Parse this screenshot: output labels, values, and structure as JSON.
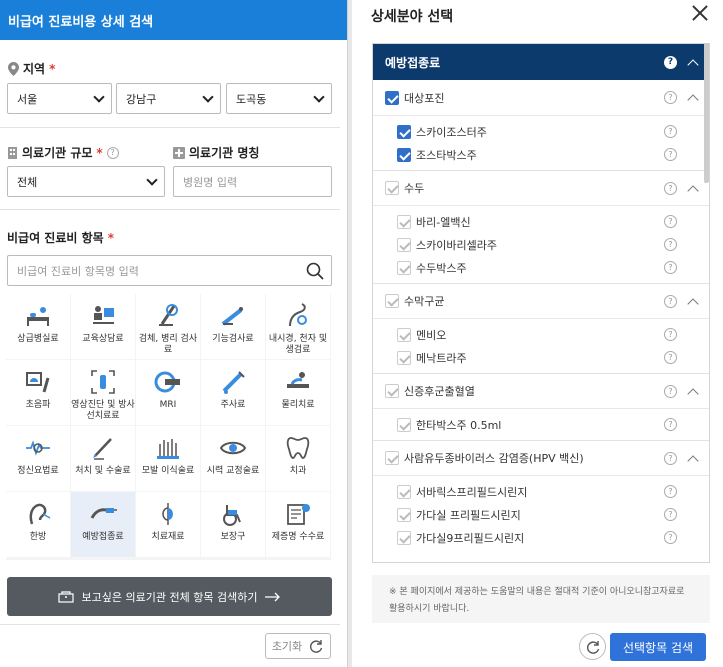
{
  "left": {
    "title": "비급여 진료비용 상세 검색",
    "region_label": "지역",
    "region": {
      "sido": "서울",
      "sigungu": "강남구",
      "dong": "도곡동"
    },
    "scale_label": "의료기관 규모",
    "scale_value": "전체",
    "name_label": "의료기관 명칭",
    "name_placeholder": "병원명 입력",
    "items_label": "비급여 진료비 항목",
    "items_placeholder": "비급여 진료비 항목명 입력",
    "categories": [
      {
        "label": "상급병실료",
        "icon": "bed-icon"
      },
      {
        "label": "교육상담료",
        "icon": "consult-icon"
      },
      {
        "label": "검체, 병리 검사료",
        "icon": "lab-icon"
      },
      {
        "label": "기능검사료",
        "icon": "function-test-icon"
      },
      {
        "label": "내시경, 천자 및 생검료",
        "icon": "endoscope-icon"
      },
      {
        "label": "초음파",
        "icon": "ultrasound-icon"
      },
      {
        "label": "영상진단 및 방사선치료료",
        "icon": "imaging-icon"
      },
      {
        "label": "MRI",
        "icon": "mri-icon"
      },
      {
        "label": "주사료",
        "icon": "syringe-icon"
      },
      {
        "label": "물리치료",
        "icon": "physio-icon"
      },
      {
        "label": "정신요법료",
        "icon": "brain-wave-icon"
      },
      {
        "label": "처치 및 수술료",
        "icon": "scalpel-icon"
      },
      {
        "label": "모발 이식술료",
        "icon": "hair-icon"
      },
      {
        "label": "시력 교정술료",
        "icon": "eye-icon"
      },
      {
        "label": "치과",
        "icon": "tooth-icon"
      },
      {
        "label": "한방",
        "icon": "acupuncture-icon"
      },
      {
        "label": "예방접종료",
        "icon": "vaccine-icon"
      },
      {
        "label": "치료재료",
        "icon": "material-icon"
      },
      {
        "label": "보장구",
        "icon": "wheelchair-icon"
      },
      {
        "label": "제증명 수수료",
        "icon": "certificate-icon"
      }
    ],
    "search_all_label": "보고싶은 의료기관 전체 항목 검색하기",
    "reset_label": "초기화"
  },
  "right": {
    "title": "상세분야 선택",
    "head": "예방접종료",
    "groups": [
      {
        "label": "대상포진",
        "checked": true,
        "children": [
          {
            "label": "스카이조스터주",
            "checked": true
          },
          {
            "label": "조스타박스주",
            "checked": true
          }
        ]
      },
      {
        "label": "수두",
        "checked": false,
        "children": [
          {
            "label": "바리-엘백신",
            "checked": false
          },
          {
            "label": "스카이바리셀라주",
            "checked": false
          },
          {
            "label": "수두박스주",
            "checked": false
          }
        ]
      },
      {
        "label": "수막구균",
        "checked": false,
        "children": [
          {
            "label": "멘비오",
            "checked": false
          },
          {
            "label": "메낙트라주",
            "checked": false
          }
        ]
      },
      {
        "label": "신증후군출혈열",
        "checked": false,
        "children": [
          {
            "label": "한타박스주 0.5ml",
            "checked": false
          }
        ]
      },
      {
        "label": "사람유두종바이러스 감염증(HPV 백신)",
        "checked": false,
        "children": [
          {
            "label": "서바릭스프리필드시린지",
            "checked": false
          },
          {
            "label": "가다실 프리필드시린지",
            "checked": false
          },
          {
            "label": "가다실9프리필드시린지",
            "checked": false
          }
        ]
      }
    ],
    "note": "※ 본 페이지에서 제공하는 도움말의 내용은 절대적 기준이 아니오니참고자료로 활용하시기 바랍니다.",
    "search_label": "선택항목 검색"
  },
  "colors": {
    "primary": "#1a7fd9",
    "navy": "#0d3a6d",
    "button": "#2f72d9",
    "dark_button": "#555a61"
  }
}
